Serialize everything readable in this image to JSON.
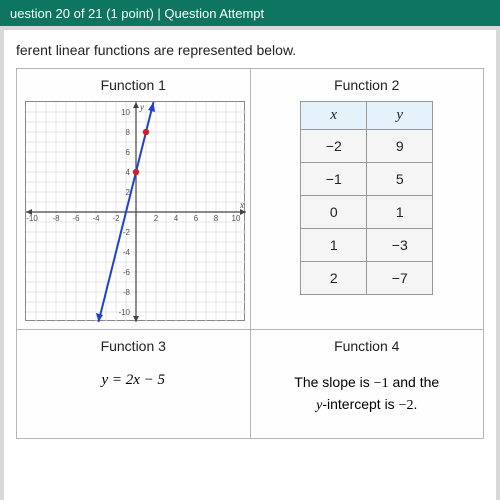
{
  "header": {
    "text": "uestion 20 of 21 (1 point)   |   Question Attempt"
  },
  "instruction": "ferent linear functions are represented below.",
  "functions": {
    "f1": {
      "title": "Function 1"
    },
    "f2": {
      "title": "Function 2",
      "xh": "x",
      "yh": "y",
      "rows": [
        {
          "x": "−2",
          "y": "9"
        },
        {
          "x": "−1",
          "y": "5"
        },
        {
          "x": "0",
          "y": "1"
        },
        {
          "x": "1",
          "y": "−3"
        },
        {
          "x": "2",
          "y": "−7"
        }
      ]
    },
    "f3": {
      "title": "Function 3",
      "eq": "y = 2x − 5"
    },
    "f4": {
      "title": "Function 4",
      "line1a": "The slope is ",
      "line1b": "−1",
      "line1c": " and the",
      "line2a": "y",
      "line2b": "-intercept is ",
      "line2c": "−2",
      "line2d": "."
    }
  },
  "chart_data": {
    "type": "line",
    "title": "Function 1",
    "xlabel": "x",
    "ylabel": "y",
    "xlim": [
      -11,
      11
    ],
    "ylim": [
      -11,
      11
    ],
    "grid": true,
    "xticks": [
      -10,
      -8,
      -6,
      -4,
      -2,
      2,
      4,
      6,
      8,
      10
    ],
    "yticks": [
      -10,
      -8,
      -6,
      -4,
      -2,
      2,
      4,
      6,
      8,
      10
    ],
    "series": [
      {
        "name": "line",
        "x": [
          -3,
          3
        ],
        "y": [
          -11,
          13
        ]
      }
    ],
    "points": [
      {
        "x": 0,
        "y": 4
      },
      {
        "x": 1,
        "y": 8
      }
    ],
    "slope": 4,
    "intercept": 4
  }
}
